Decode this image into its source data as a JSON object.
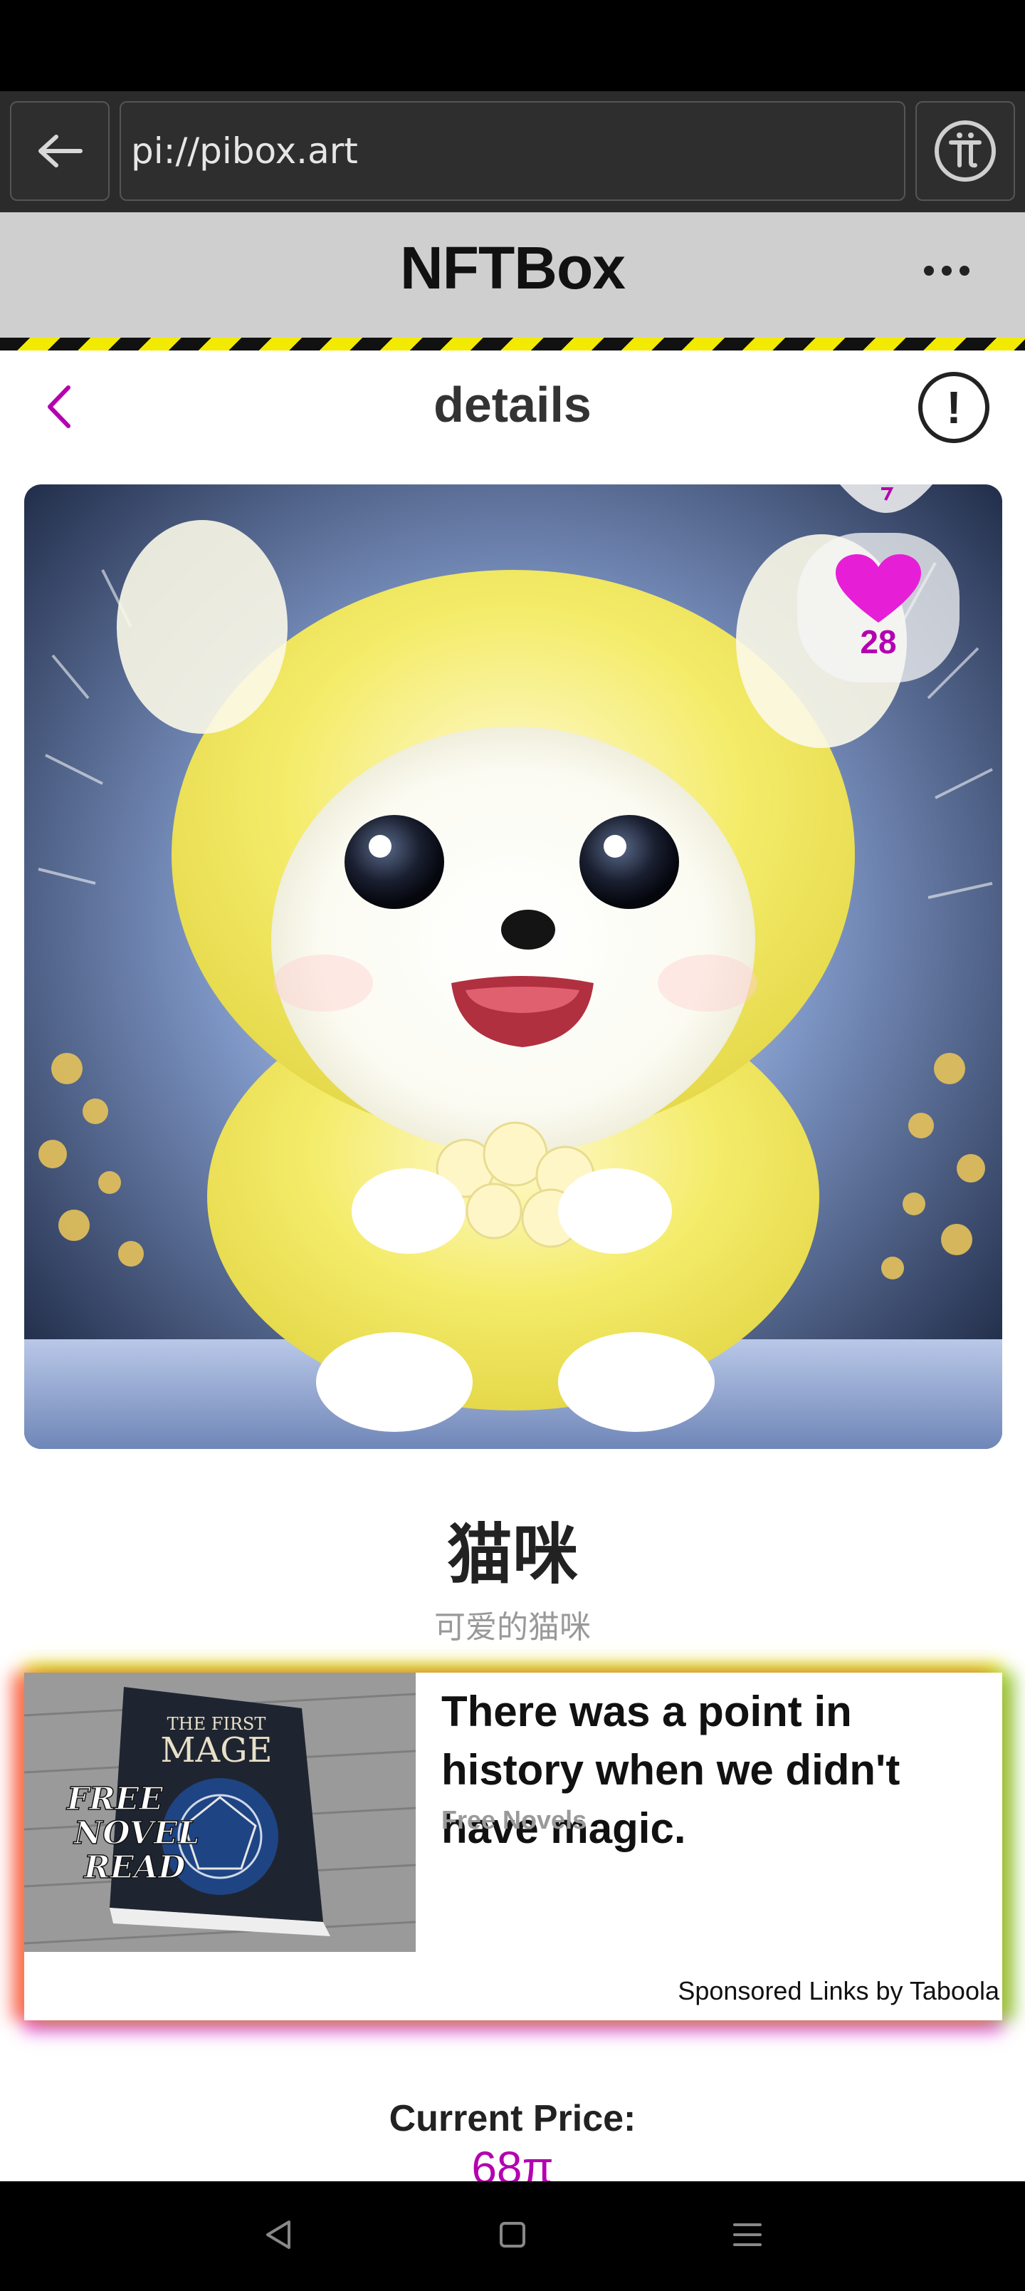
{
  "browser": {
    "url": "pi://pibox.art",
    "back_icon": "arrow-left-icon",
    "pi_icon": "pi-logo-icon"
  },
  "app": {
    "title": "NFTBox",
    "more_icon": "more-dots-icon"
  },
  "page": {
    "title": "details",
    "back_icon": "chevron-left-icon",
    "info_icon": "info-alert-icon",
    "info_symbol": "!"
  },
  "nft": {
    "name": "猫咪",
    "description": "可爱的猫咪",
    "likes": "28",
    "image_icon": "yellow-puppy-artwork"
  },
  "ad": {
    "headline": "There was a point in history when we didn't have magic.",
    "source": "Free Novels",
    "sponsor": "Sponsored Links by Taboola",
    "book_title_line1": "THE FIRST",
    "book_title_line2": "MAGE",
    "overlay_line1": "FREE",
    "overlay_line2": "NOVEL",
    "overlay_line3": "READ"
  },
  "price": {
    "label": "Current Price:",
    "value": "68π"
  },
  "colors": {
    "accent": "#b400b0",
    "header_bg": "#cfcfcf",
    "browser_bg": "#2b2b2b",
    "hazard_yellow": "#f2ea00"
  }
}
